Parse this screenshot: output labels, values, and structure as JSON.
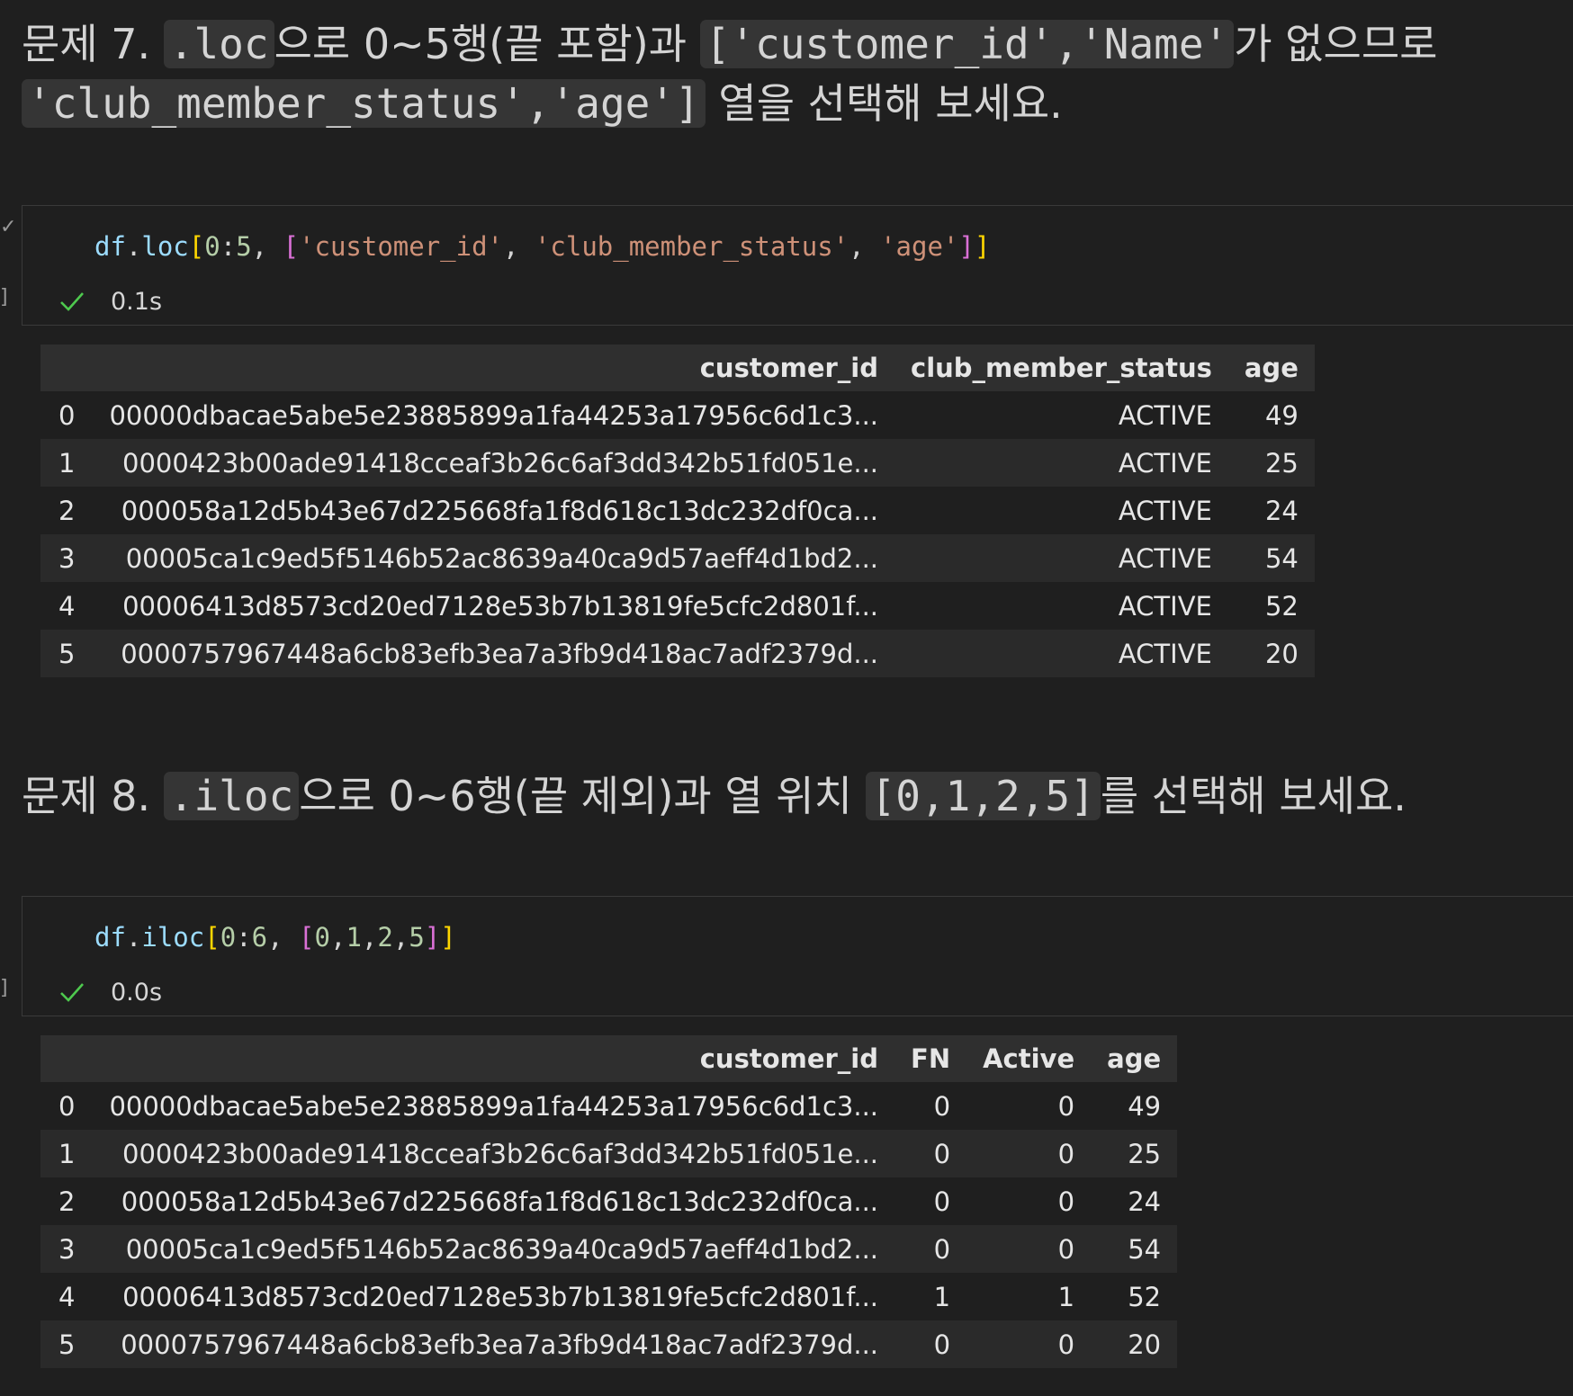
{
  "q7": {
    "label": "문제 7.",
    "code1": ".loc",
    "text1": "으로 0~5행(끝 포함)과",
    "code2": "['customer_id','Name'",
    "text2": "가 없으므로",
    "code3": "'club_member_status','age']",
    "text3": "열을 선택해 보세요."
  },
  "cell1": {
    "code_tokens": [
      "df",
      ".",
      "loc",
      "[",
      "0",
      ":",
      "5",
      ", ",
      "[",
      "'customer_id'",
      ", ",
      "'club_member_status'",
      ", ",
      "'age'",
      "]",
      "]"
    ],
    "status_time": "0.1s"
  },
  "table1": {
    "headers": [
      "",
      "customer_id",
      "club_member_status",
      "age"
    ],
    "rows": [
      [
        "0",
        "00000dbacae5abe5e23885899a1fa44253a17956c6d1c3...",
        "ACTIVE",
        "49"
      ],
      [
        "1",
        "0000423b00ade91418cceaf3b26c6af3dd342b51fd051e...",
        "ACTIVE",
        "25"
      ],
      [
        "2",
        "000058a12d5b43e67d225668fa1f8d618c13dc232df0ca...",
        "ACTIVE",
        "24"
      ],
      [
        "3",
        "00005ca1c9ed5f5146b52ac8639a40ca9d57aeff4d1bd2...",
        "ACTIVE",
        "54"
      ],
      [
        "4",
        "00006413d8573cd20ed7128e53b7b13819fe5cfc2d801f...",
        "ACTIVE",
        "52"
      ],
      [
        "5",
        "000075796744 8a6cb83efb3ea7a3fb9d418ac7adf2379d...",
        "ACTIVE",
        "20"
      ]
    ]
  },
  "q8": {
    "label": "문제 8.",
    "code1": ".iloc",
    "text1": "으로 0~6행(끝 제외)과 열 위치",
    "code2": "[0,1,2,5]",
    "text2": "를 선택해 보세요."
  },
  "cell2": {
    "code_tokens": [
      "df",
      ".",
      "iloc",
      "[",
      "0",
      ":",
      "6",
      ", ",
      "[",
      "0",
      ",",
      "1",
      ",",
      "2",
      ",",
      "5",
      "]",
      "]"
    ],
    "status_time": "0.0s"
  },
  "table2": {
    "headers": [
      "",
      "customer_id",
      "FN",
      "Active",
      "age"
    ],
    "rows": [
      [
        "0",
        "00000dbacae5abe5e23885899a1fa44253a17956c6d1c3...",
        "0",
        "0",
        "49"
      ],
      [
        "1",
        "0000423b00ade91418cceaf3b26c6af3dd342b51fd051e...",
        "0",
        "0",
        "25"
      ],
      [
        "2",
        "000058a12d5b43e67d225668fa1f8d618c13dc232df0ca...",
        "0",
        "0",
        "24"
      ],
      [
        "3",
        "00005ca1c9ed5f5146b52ac8639a40ca9d57aeff4d1bd2...",
        "0",
        "0",
        "54"
      ],
      [
        "4",
        "00006413d8573cd20ed7128e53b7b13819fe5cfc2d801f...",
        "1",
        "1",
        "52"
      ],
      [
        "5",
        "0000757967448a6cb83efb3ea7a3fb9d418ac7adf2379d...",
        "0",
        "0",
        "20"
      ]
    ]
  }
}
